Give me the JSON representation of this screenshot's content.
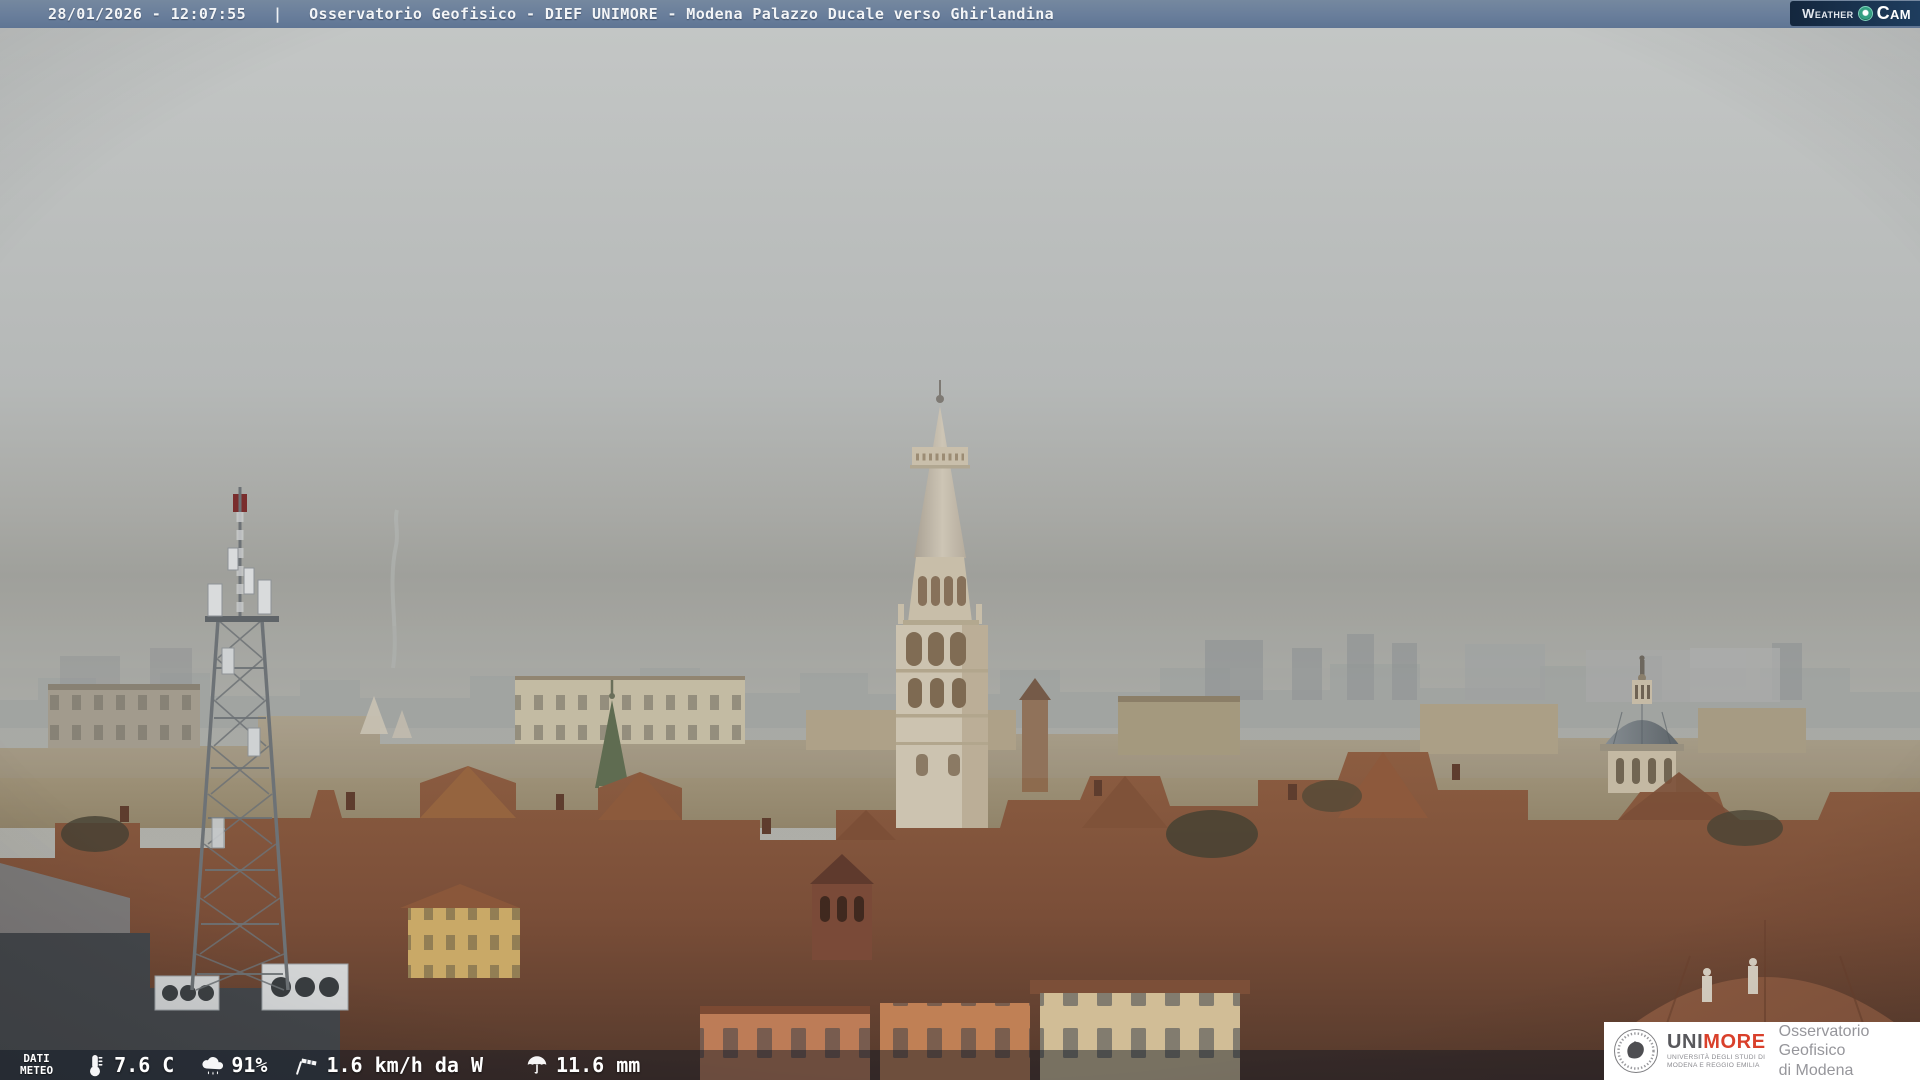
{
  "header": {
    "datetime": "28/01/2026 - 12:07:55",
    "separator": "|",
    "title": "Osservatorio Geofisico - DIEF UNIMORE - Modena Palazzo Ducale verso Ghirlandina",
    "logo": {
      "weather": "Weather",
      "cam": "Cam"
    }
  },
  "weather_bar": {
    "label_line1": "DATI",
    "label_line2": "METEO",
    "temperature": "7.6 C",
    "humidity": "91%",
    "wind": "1.6 km/h da W",
    "rain": "11.6 mm"
  },
  "branding": {
    "uni": "UNI",
    "more": "MORE",
    "sub_line1": "UNIVERSITÀ DEGLI STUDI DI",
    "sub_line2": "MODENA E REGGIO EMILIA",
    "obs_line1": "Osservatorio Geofisico",
    "obs_line2": "di Modena"
  },
  "icons": {
    "temperature": "thermometer-icon",
    "humidity": "humidity-cloud-icon",
    "wind": "windsock-icon",
    "rain": "umbrella-icon",
    "logo_dot": "camera-lens-icon",
    "seal": "unimore-seal-icon"
  },
  "colors": {
    "header_bar": "#697e9b",
    "logo_navy": "#14273e",
    "logo_teal": "#35a083",
    "overlay_bar": "rgba(10,19,33,0.45)",
    "accent_red": "#d9402b",
    "text_white": "#f3f5f7",
    "sky_top": "#c3c6c5",
    "sky_haze_band": "#9fa09b",
    "roof_terracotta": "#7a4e38",
    "stone_cream": "#ccc3b0"
  }
}
